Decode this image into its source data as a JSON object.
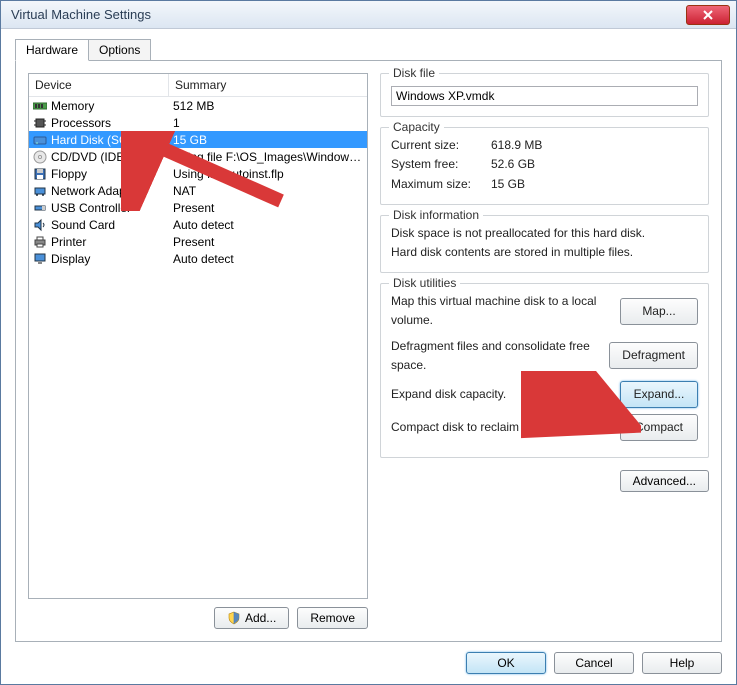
{
  "window": {
    "title": "Virtual Machine Settings"
  },
  "tabs": {
    "hardware": "Hardware",
    "options": "Options"
  },
  "deviceHeader": {
    "device": "Device",
    "summary": "Summary"
  },
  "devices": [
    {
      "name": "Memory",
      "summary": "512 MB",
      "icon": "memory"
    },
    {
      "name": "Processors",
      "summary": "1",
      "icon": "cpu"
    },
    {
      "name": "Hard Disk (SCSI)",
      "summary": "15 GB",
      "icon": "disk",
      "selected": true
    },
    {
      "name": "CD/DVD (IDE)",
      "summary": "Using file F:\\OS_Images\\Windows...",
      "icon": "cd"
    },
    {
      "name": "Floppy",
      "summary": "Using file autoinst.flp",
      "icon": "floppy"
    },
    {
      "name": "Network Adapter",
      "summary": "NAT",
      "icon": "net"
    },
    {
      "name": "USB Controller",
      "summary": "Present",
      "icon": "usb"
    },
    {
      "name": "Sound Card",
      "summary": "Auto detect",
      "icon": "sound"
    },
    {
      "name": "Printer",
      "summary": "Present",
      "icon": "printer"
    },
    {
      "name": "Display",
      "summary": "Auto detect",
      "icon": "display"
    }
  ],
  "leftButtons": {
    "add": "Add...",
    "remove": "Remove"
  },
  "diskFile": {
    "title": "Disk file",
    "value": "Windows XP.vmdk"
  },
  "capacity": {
    "title": "Capacity",
    "currentLabel": "Current size:",
    "currentVal": "618.9 MB",
    "freeLabel": "System free:",
    "freeVal": "52.6 GB",
    "maxLabel": "Maximum size:",
    "maxVal": "15 GB"
  },
  "diskInfo": {
    "title": "Disk information",
    "line1": "Disk space is not preallocated for this hard disk.",
    "line2": "Hard disk contents are stored in multiple files."
  },
  "utilities": {
    "title": "Disk utilities",
    "mapDesc": "Map this virtual machine disk to a local volume.",
    "mapBtn": "Map...",
    "defragDesc": "Defragment files and consolidate free space.",
    "defragBtn": "Defragment",
    "expandDesc": "Expand disk capacity.",
    "expandBtn": "Expand...",
    "compactDesc": "Compact disk to reclaim unused space.",
    "compactBtn": "Compact"
  },
  "advanced": "Advanced...",
  "footer": {
    "ok": "OK",
    "cancel": "Cancel",
    "help": "Help"
  }
}
